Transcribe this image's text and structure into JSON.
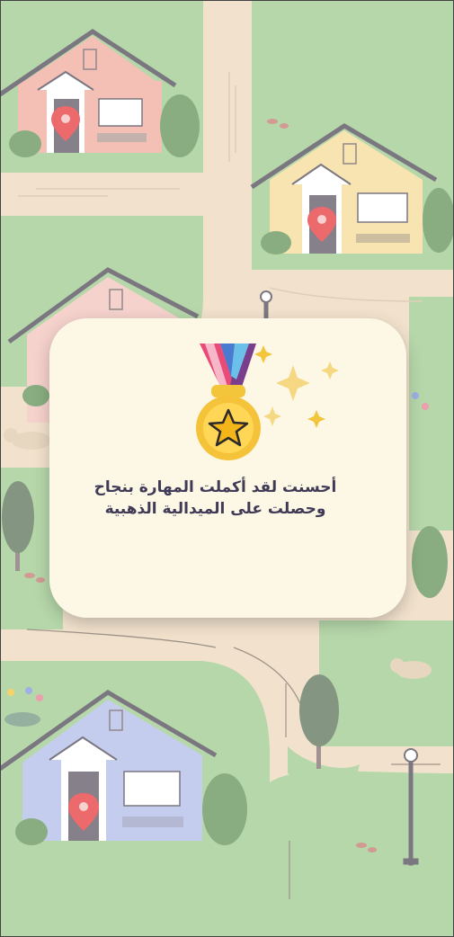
{
  "dialog": {
    "message_line1": "أحسنت لقد أكملت  المهارة بنجاح",
    "message_line2": "وحصلت على الميدالية الذهبية",
    "icon": "gold-medal-star-icon"
  },
  "map": {
    "houses": [
      {
        "name": "house-pink",
        "color": "#f2b3a6",
        "marker": true
      },
      {
        "name": "house-yellow",
        "color": "#f6dea0",
        "marker": true
      },
      {
        "name": "house-light-pink",
        "color": "#f4c9c3",
        "marker": false
      },
      {
        "name": "house-blue",
        "color": "#b9c2ec",
        "marker": true
      }
    ],
    "colors": {
      "grass": "#a6cf98",
      "path": "#f0dcc2",
      "marker": "#e8484c",
      "card": "#fdf8e6",
      "text": "#3f3a55"
    }
  }
}
